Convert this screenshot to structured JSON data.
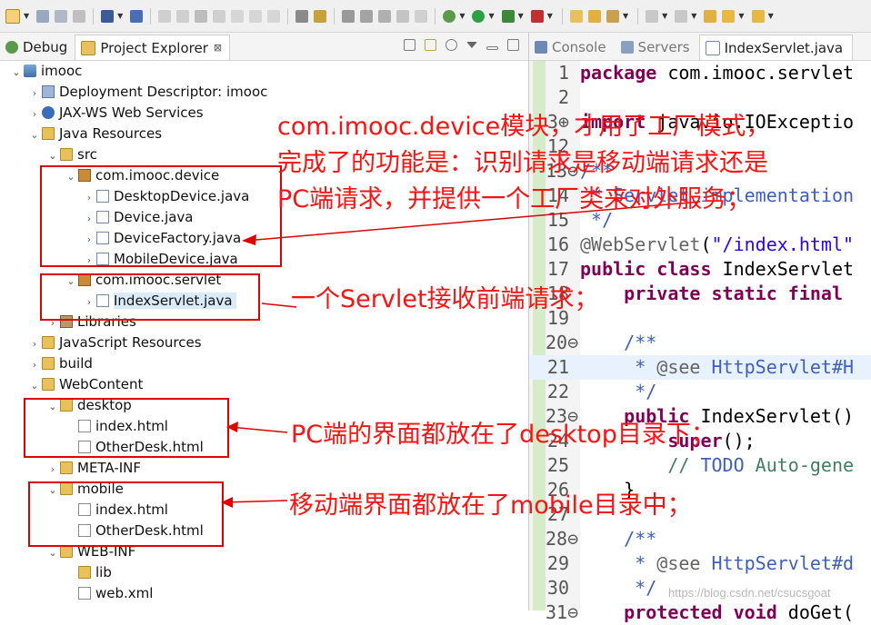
{
  "left_tabs": [
    {
      "label": "Debug"
    },
    {
      "label": "Project Explorer",
      "close": "⊠"
    }
  ],
  "tree": [
    {
      "label": "imooc",
      "twisty": "v",
      "icon": "proj"
    },
    {
      "label": "Deployment Descriptor: imooc",
      "twisty": ">",
      "icon": "desc"
    },
    {
      "label": "JAX-WS Web Services",
      "twisty": ">",
      "icon": "ws"
    },
    {
      "label": "Java Resources",
      "twisty": "v",
      "icon": "folder"
    },
    {
      "label": "src",
      "twisty": "v",
      "icon": "folder"
    },
    {
      "label": "com.imooc.device",
      "twisty": "v",
      "icon": "pkg"
    },
    {
      "label": "DesktopDevice.java",
      "twisty": ">",
      "icon": "java"
    },
    {
      "label": "Device.java",
      "twisty": ">",
      "icon": "java"
    },
    {
      "label": "DeviceFactory.java",
      "twisty": ">",
      "icon": "java"
    },
    {
      "label": "MobileDevice.java",
      "twisty": ">",
      "icon": "java"
    },
    {
      "label": "com.imooc.servlet",
      "twisty": "v",
      "icon": "pkg"
    },
    {
      "label": "IndexServlet.java",
      "twisty": ">",
      "icon": "java"
    },
    {
      "label": "Libraries",
      "twisty": ">",
      "icon": "lib"
    },
    {
      "label": "JavaScript Resources",
      "twisty": ">",
      "icon": "folder"
    },
    {
      "label": "build",
      "twisty": ">",
      "icon": "folder"
    },
    {
      "label": "WebContent",
      "twisty": "v",
      "icon": "folder"
    },
    {
      "label": "desktop",
      "twisty": "v",
      "icon": "folder"
    },
    {
      "label": "index.html",
      "twisty": "",
      "icon": "html"
    },
    {
      "label": "OtherDesk.html",
      "twisty": "",
      "icon": "html"
    },
    {
      "label": "META-INF",
      "twisty": ">",
      "icon": "folder"
    },
    {
      "label": "mobile",
      "twisty": "v",
      "icon": "folder"
    },
    {
      "label": "index.html",
      "twisty": "",
      "icon": "html"
    },
    {
      "label": "OtherDesk.html",
      "twisty": "",
      "icon": "html"
    },
    {
      "label": "WEB-INF",
      "twisty": "v",
      "icon": "folder"
    },
    {
      "label": "lib",
      "twisty": "",
      "icon": "folder"
    },
    {
      "label": "web.xml",
      "twisty": "",
      "icon": "xml"
    }
  ],
  "right_tabs": [
    {
      "label": "Console"
    },
    {
      "label": "Servers"
    },
    {
      "label": "IndexServlet.java"
    }
  ],
  "code_lines": [
    {
      "num": "1",
      "parts": [
        [
          "kw",
          "package"
        ],
        [
          "plain",
          " com.imooc.servlet"
        ]
      ]
    },
    {
      "num": "2",
      "parts": []
    },
    {
      "num": "3⊕",
      "parts": [
        [
          "kw",
          "import"
        ],
        [
          "plain",
          " java.io.IOExceptio"
        ]
      ]
    },
    {
      "num": "12",
      "parts": []
    },
    {
      "num": "13⊖",
      "parts": [
        [
          "cm",
          "/**"
        ]
      ]
    },
    {
      "num": "14",
      "parts": [
        [
          "cm",
          " * Servlet implementation"
        ]
      ]
    },
    {
      "num": "15",
      "parts": [
        [
          "cm",
          " */"
        ]
      ]
    },
    {
      "num": "16",
      "parts": [
        [
          "ann",
          "@WebServlet"
        ],
        [
          "plain",
          "("
        ],
        [
          "str",
          "\"/index.html\""
        ]
      ]
    },
    {
      "num": "17",
      "parts": [
        [
          "kw",
          "public class"
        ],
        [
          "plain",
          " IndexServlet"
        ]
      ]
    },
    {
      "num": "18",
      "parts": [
        [
          "plain",
          "    "
        ],
        [
          "kw",
          "private static final"
        ]
      ]
    },
    {
      "num": "19",
      "parts": []
    },
    {
      "num": "20⊖",
      "parts": [
        [
          "plain",
          "    "
        ],
        [
          "cm",
          "/**"
        ]
      ]
    },
    {
      "num": "21",
      "hl": true,
      "parts": [
        [
          "cm",
          "     * "
        ],
        [
          "ann",
          "@see"
        ],
        [
          "cm",
          " HttpServlet#H"
        ]
      ]
    },
    {
      "num": "22",
      "parts": [
        [
          "cm",
          "     */"
        ]
      ]
    },
    {
      "num": "23⊖",
      "parts": [
        [
          "plain",
          "    "
        ],
        [
          "kw",
          "public"
        ],
        [
          "plain",
          " IndexServlet()"
        ]
      ]
    },
    {
      "num": "24",
      "parts": [
        [
          "plain",
          "        "
        ],
        [
          "kw",
          "super"
        ],
        [
          "plain",
          "();"
        ]
      ]
    },
    {
      "num": "25",
      "parts": [
        [
          "plain",
          "        "
        ],
        [
          "cmt",
          "// "
        ],
        [
          "cm",
          "TODO"
        ],
        [
          "cmt",
          " Auto-gene"
        ]
      ]
    },
    {
      "num": "26",
      "parts": [
        [
          "plain",
          "    }"
        ]
      ]
    },
    {
      "num": "27",
      "parts": []
    },
    {
      "num": "28⊖",
      "parts": [
        [
          "plain",
          "    "
        ],
        [
          "cm",
          "/**"
        ]
      ]
    },
    {
      "num": "29",
      "parts": [
        [
          "cm",
          "     * "
        ],
        [
          "ann",
          "@see"
        ],
        [
          "cm",
          " HttpServlet#d"
        ]
      ]
    },
    {
      "num": "30",
      "parts": [
        [
          "cm",
          "     */"
        ]
      ]
    },
    {
      "num": "31⊖",
      "parts": [
        [
          "plain",
          "    "
        ],
        [
          "kw",
          "protected void"
        ],
        [
          "plain",
          " doGet("
        ]
      ]
    }
  ],
  "annotations": {
    "device_note_1": "com.imooc.device模块，才用了工厂模式，",
    "device_note_2": "完成了的功能是：识别请求是移动端请求还是",
    "device_note_3": "PC端请求，并提供一个工厂类来对外服务；",
    "servlet_note": "一个Servlet接收前端请求；",
    "desktop_note": "PC端的界面都放在了desktop目录下；",
    "mobile_note": "移动端界面都放在了mobile目录中；"
  },
  "watermark": "https://blog.csdn.net/csucsgoat",
  "colors": {
    "annotation": "#ff1111",
    "keyword": "#7f0055",
    "comment": "#3f5fbf",
    "string": "#2a00ff"
  }
}
